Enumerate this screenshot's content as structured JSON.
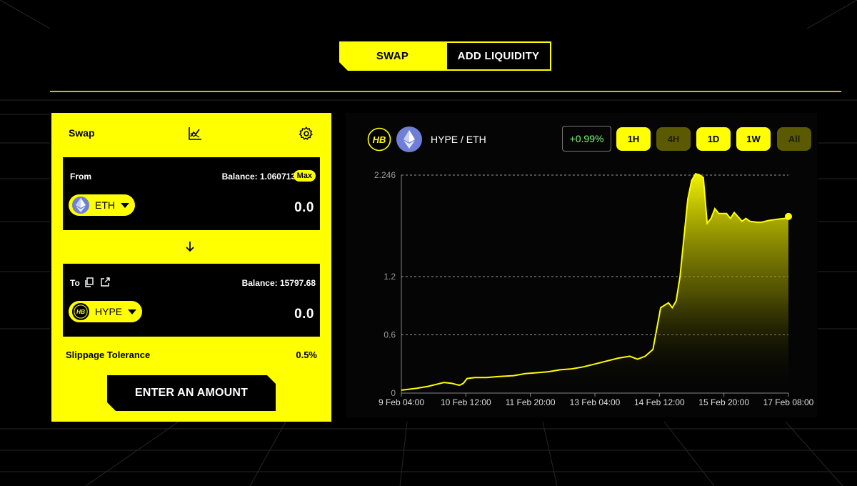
{
  "tabs": {
    "swap": "SWAP",
    "add_liquidity": "ADD LIQUIDITY"
  },
  "swap_card": {
    "title": "Swap",
    "from": {
      "label": "From",
      "balance": "Balance: 1.060713",
      "max_label": "Max",
      "token": "ETH",
      "amount": "0.0"
    },
    "to": {
      "label": "To",
      "balance": "Balance: 15797.68",
      "token": "HYPE",
      "amount": "0.0"
    },
    "slippage_label": "Slippage Tolerance",
    "slippage_value": "0.5%",
    "submit_label": "ENTER AN AMOUNT"
  },
  "chart_panel": {
    "pair": "HYPE / ETH",
    "change": "+0.99%",
    "timeframes": [
      {
        "label": "1H",
        "active": true
      },
      {
        "label": "4H",
        "active": false
      },
      {
        "label": "1D",
        "active": true
      },
      {
        "label": "1W",
        "active": true
      },
      {
        "label": "All",
        "active": false
      }
    ]
  },
  "colors": {
    "accent": "#ffff00",
    "background": "#000000",
    "positive": "#7cff7c",
    "dim_button": "#5c5a00"
  },
  "icons": {
    "chart_toggle": "chart-line-icon",
    "settings": "gear-icon",
    "swap_direction": "arrow-down-icon",
    "copy": "copy-icon",
    "external": "external-link-icon",
    "eth": "ethereum-icon",
    "hype": "hb-logo-icon"
  },
  "chart_data": {
    "type": "area",
    "title": "",
    "xlabel": "",
    "ylabel": "",
    "x_ticks": [
      "9 Feb 04:00",
      "10 Feb 12:00",
      "11 Feb 20:00",
      "13 Feb 04:00",
      "14 Feb 12:00",
      "15 Feb 20:00",
      "17 Feb 08:00"
    ],
    "y_ticks": [
      0,
      0.6,
      1.2,
      2.246
    ],
    "ylim": [
      0,
      2.246
    ],
    "grid": "horizontal dashed",
    "series": [
      {
        "x": [
          0,
          0.04,
          0.07,
          0.09,
          0.11,
          0.13,
          0.15,
          0.16,
          0.17,
          0.19,
          0.22,
          0.25,
          0.29,
          0.32,
          0.35,
          0.38,
          0.41,
          0.44,
          0.47,
          0.5,
          0.53,
          0.56,
          0.59,
          0.61,
          0.63,
          0.65,
          0.67,
          0.69,
          0.7,
          0.71,
          0.72,
          0.74,
          0.75,
          0.76,
          0.77,
          0.78,
          0.79,
          0.8,
          0.81,
          0.82,
          0.84,
          0.85,
          0.86,
          0.88,
          0.89,
          0.9,
          0.92,
          0.93,
          0.95,
          0.97,
          0.99,
          1.0
        ],
        "values": [
          0.03,
          0.05,
          0.07,
          0.09,
          0.11,
          0.1,
          0.08,
          0.1,
          0.15,
          0.16,
          0.16,
          0.17,
          0.18,
          0.2,
          0.21,
          0.22,
          0.24,
          0.25,
          0.27,
          0.3,
          0.33,
          0.36,
          0.38,
          0.35,
          0.38,
          0.45,
          0.88,
          0.93,
          0.88,
          0.95,
          1.2,
          2.0,
          2.19,
          2.26,
          2.25,
          2.22,
          1.75,
          1.8,
          1.9,
          1.85,
          1.85,
          1.8,
          1.86,
          1.77,
          1.8,
          1.77,
          1.76,
          1.76,
          1.78,
          1.79,
          1.8,
          1.82
        ]
      }
    ]
  }
}
